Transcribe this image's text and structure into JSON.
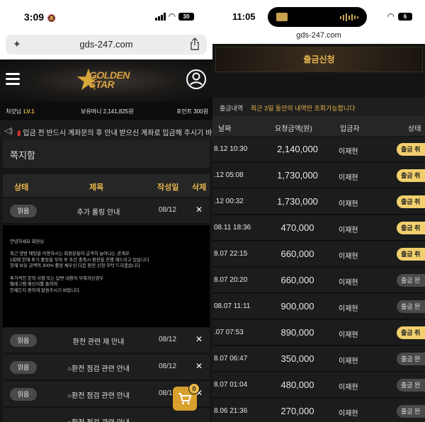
{
  "left": {
    "status_time": "3:09",
    "battery": "30",
    "url": "gds-247.com",
    "logo": "GOLDEN STAR",
    "nickname": "처갓님",
    "level": "LV.1",
    "balance": "보유머니 2,141,825원",
    "points": "포인트 300원",
    "ticker": "입금 전 반드시 계좌문의 후 안내 받으신 계좌로 입금해 주시기 바랍니",
    "section_title": "쪽지함",
    "columns": [
      "상태",
      "제목",
      "작성일",
      "삭제"
    ],
    "rows": [
      {
        "status": "읽음",
        "subject": "추가 롤링 안내",
        "date": "08/12",
        "del": "✕"
      },
      {
        "status": "읽음",
        "subject": "환전 관련 재 안내",
        "date": "08/12",
        "del": "✕"
      },
      {
        "status": "읽음",
        "subject": "○환전 점검 관련 안내",
        "date": "08/12",
        "del": "✕"
      },
      {
        "status": "읽음",
        "subject": "○환전 점검 관련 안내",
        "date": "08/1",
        "del": "✕"
      },
      {
        "status": "",
        "subject": "○환전 점검 관련 안내",
        "date": "",
        "del": ""
      }
    ],
    "message_lines": [
      "안녕하세요 회원님",
      "",
      "최근 양방 배팅을 이용하시는 회원분들이 급격히 늘어나는 관계로",
      "1회에 한해 추가 롤링을 부여 후 조건 충족시 환전을 진행 해드리고 있습니다",
      "현재 보유 금액의 300% 롤링 채우신 다음 환전 신청 부탁 드리겠습니다",
      "",
      "추가적인 문의 사항 또는 답변 내용이 부족하신경우",
      "텔레그램 메신저를 통하여",
      "언제든지 편하게 말씀주시기 바랍니다."
    ],
    "cart_count": "0"
  },
  "right": {
    "status_time": "11:05",
    "battery": "6",
    "url": "gds-247.com",
    "page_title": "출금신청",
    "history_label": "출금내역",
    "history_hint": "최근 3일 동안의 내역만 조회가능합니다",
    "columns": [
      "날짜",
      "요청금액(원)",
      "입금자",
      "상태"
    ],
    "rows": [
      {
        "date": "8.12 10:30",
        "amount": "2,140,000",
        "name": "이재현",
        "status": "출금 취",
        "state": "pend"
      },
      {
        "date": ".12 05:08",
        "amount": "1,730,000",
        "name": "이재현",
        "status": "출금 취",
        "state": "pend"
      },
      {
        "date": ".12 00:32",
        "amount": "1,730,000",
        "name": "이재현",
        "status": "출금 취",
        "state": "pend"
      },
      {
        "date": "08.11 18:36",
        "amount": "470,000",
        "name": "이재현",
        "status": "출금 취",
        "state": "pend"
      },
      {
        "date": "8.07 22:15",
        "amount": "660,000",
        "name": "이재현",
        "status": "출금 취",
        "state": "pend"
      },
      {
        "date": "8.07 20:20",
        "amount": "660,000",
        "name": "이재현",
        "status": "출금 완",
        "state": "done"
      },
      {
        "date": "08.07 11:11",
        "amount": "900,000",
        "name": "이재현",
        "status": "출금 완",
        "state": "done"
      },
      {
        "date": ".07 07:53",
        "amount": "890,000",
        "name": "이재현",
        "status": "출금 취",
        "state": "pend"
      },
      {
        "date": "8.07 06:47",
        "amount": "350,000",
        "name": "이재현",
        "status": "출금 완",
        "state": "done"
      },
      {
        "date": "8.07 01:04",
        "amount": "480,000",
        "name": "이재현",
        "status": "출금 완",
        "state": "done"
      },
      {
        "date": "8.06 21:36",
        "amount": "270,000",
        "name": "이재현",
        "status": "출금 완",
        "state": "done"
      }
    ]
  }
}
